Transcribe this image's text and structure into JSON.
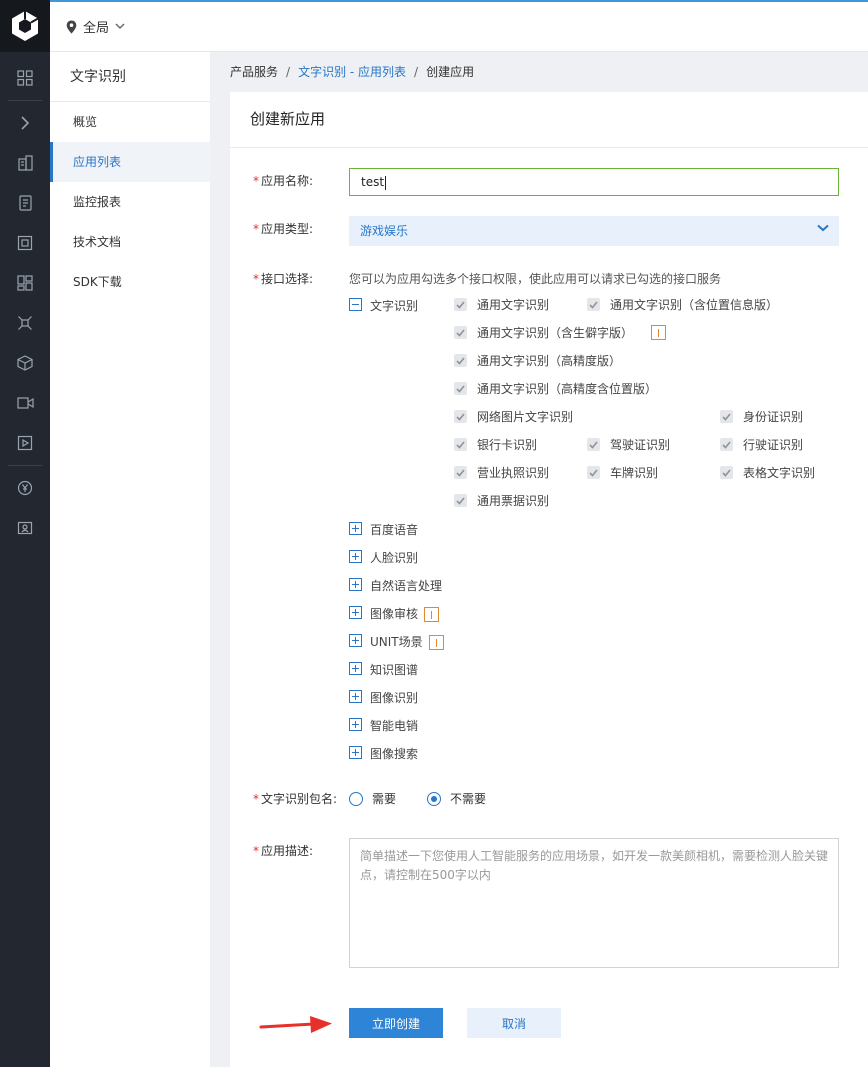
{
  "topbar": {
    "region": "全局"
  },
  "sidenav": {
    "title": "文字识别",
    "items": [
      "概览",
      "应用列表",
      "监控报表",
      "技术文档",
      "SDK下载"
    ]
  },
  "breadcrumb": {
    "root": "产品服务",
    "link": "文字识别 - 应用列表",
    "current": "创建应用"
  },
  "form": {
    "heading": "创建新应用",
    "name_label": "应用名称:",
    "name_value": "test",
    "type_label": "应用类型:",
    "type_value": "游戏娱乐",
    "api_label": "接口选择:",
    "api_hint": "您可以为应用勾选多个接口权限，使此应用可以请求已勾选的接口服务",
    "ocr_group": "文字识别",
    "ocr_items": [
      "通用文字识别",
      "通用文字识别（含位置信息版）",
      "通用文字识别（含生僻字版）",
      "通用文字识别（高精度版）",
      "通用文字识别（高精度含位置版）",
      "网络图片文字识别",
      "身份证识别",
      "银行卡识别",
      "驾驶证识别",
      "行驶证识别",
      "营业执照识别",
      "车牌识别",
      "表格文字识别",
      "通用票据识别"
    ],
    "other_groups": [
      "百度语音",
      "人脸识别",
      "自然语言处理",
      "图像审核",
      "UNIT场景",
      "知识图谱",
      "图像识别",
      "智能电销",
      "图像搜索"
    ],
    "package_label": "文字识别包名:",
    "package_options": [
      "需要",
      "不需要"
    ],
    "package_selected": "不需要",
    "desc_label": "应用描述:",
    "desc_placeholder": "简单描述一下您使用人工智能服务的应用场景，如开发一款美颜相机，需要检测人脸关键点，请控制在500字以内",
    "submit": "立即创建",
    "cancel": "取消"
  },
  "colors": {
    "accent": "#2876c8",
    "primary_button": "#2e84d6",
    "rail": "#232830",
    "required": "#e0332b",
    "warning": "#e08a2d",
    "arrow": "#e8302a"
  }
}
